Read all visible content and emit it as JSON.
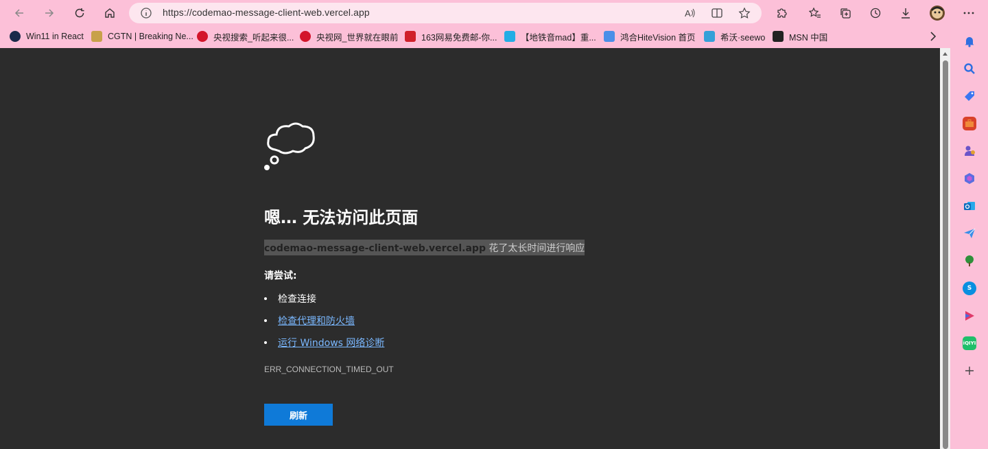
{
  "browser": {
    "url": "https://codemao-message-client-web.vercel.app"
  },
  "bookmarks": [
    {
      "label": "Win11 in React",
      "icon": "win11-react-icon",
      "color": "#1b2a4a"
    },
    {
      "label": "CGTN | Breaking Ne...",
      "icon": "cgtn-icon",
      "color": "#c8a14a"
    },
    {
      "label": "央视搜索_听起来很...",
      "icon": "cctv-search-icon",
      "color": "#d3142a"
    },
    {
      "label": "央视网_世界就在眼前",
      "icon": "cctv-icon",
      "color": "#d3142a"
    },
    {
      "label": "163网易免费邮-你...",
      "icon": "netease-mail-icon",
      "color": "#d0202a"
    },
    {
      "label": "【地铁音mad】重...",
      "icon": "bilibili-icon",
      "color": "#23ade5"
    },
    {
      "label": "鸿合HiteVision 首页",
      "icon": "hitevision-icon",
      "color": "#4a8fe8"
    },
    {
      "label": "希沃·seewo",
      "icon": "seewo-icon",
      "color": "#35a0d8"
    },
    {
      "label": "MSN 中国",
      "icon": "msn-icon",
      "color": "#222222"
    }
  ],
  "error_page": {
    "title": "嗯… 无法访问此页面",
    "host": "codemao-message-client-web.vercel.app",
    "message": " 花了太长时间进行响应",
    "try_label": "请尝试:",
    "suggestions": [
      {
        "text": "检查连接",
        "link": false
      },
      {
        "text": "检查代理和防火墙",
        "link": true
      },
      {
        "text": "运行 Windows 网络诊断",
        "link": true
      }
    ],
    "error_code": "ERR_CONNECTION_TIMED_OUT",
    "refresh_label": "刷新"
  },
  "sidebar": [
    {
      "icon": "notification-bell-icon",
      "color": "#2f6fe0"
    },
    {
      "icon": "search-icon",
      "color": "#2f6fe0"
    },
    {
      "icon": "shopping-tag-icon",
      "color": "#3a76f0"
    },
    {
      "icon": "tools-briefcase-icon",
      "color": "#d9412a"
    },
    {
      "icon": "games-icon",
      "color": "#6b54c8"
    },
    {
      "icon": "copilot-icon",
      "color": "#5b6ee0"
    },
    {
      "icon": "outlook-icon",
      "color": "#0f6cbd"
    },
    {
      "icon": "send-icon",
      "color": "#3a8ee8"
    },
    {
      "icon": "tree-icon",
      "color": "#2f8f3a"
    },
    {
      "icon": "skype-icon",
      "color": "#0a8fe0"
    },
    {
      "icon": "video-app-icon",
      "color": "#e03a6a"
    },
    {
      "icon": "iqiyi-icon",
      "color": "#1fbf6a"
    },
    {
      "icon": "add-icon",
      "color": "#444444"
    }
  ],
  "sidebar_labels": {
    "iqiyi": "iQIYI"
  }
}
